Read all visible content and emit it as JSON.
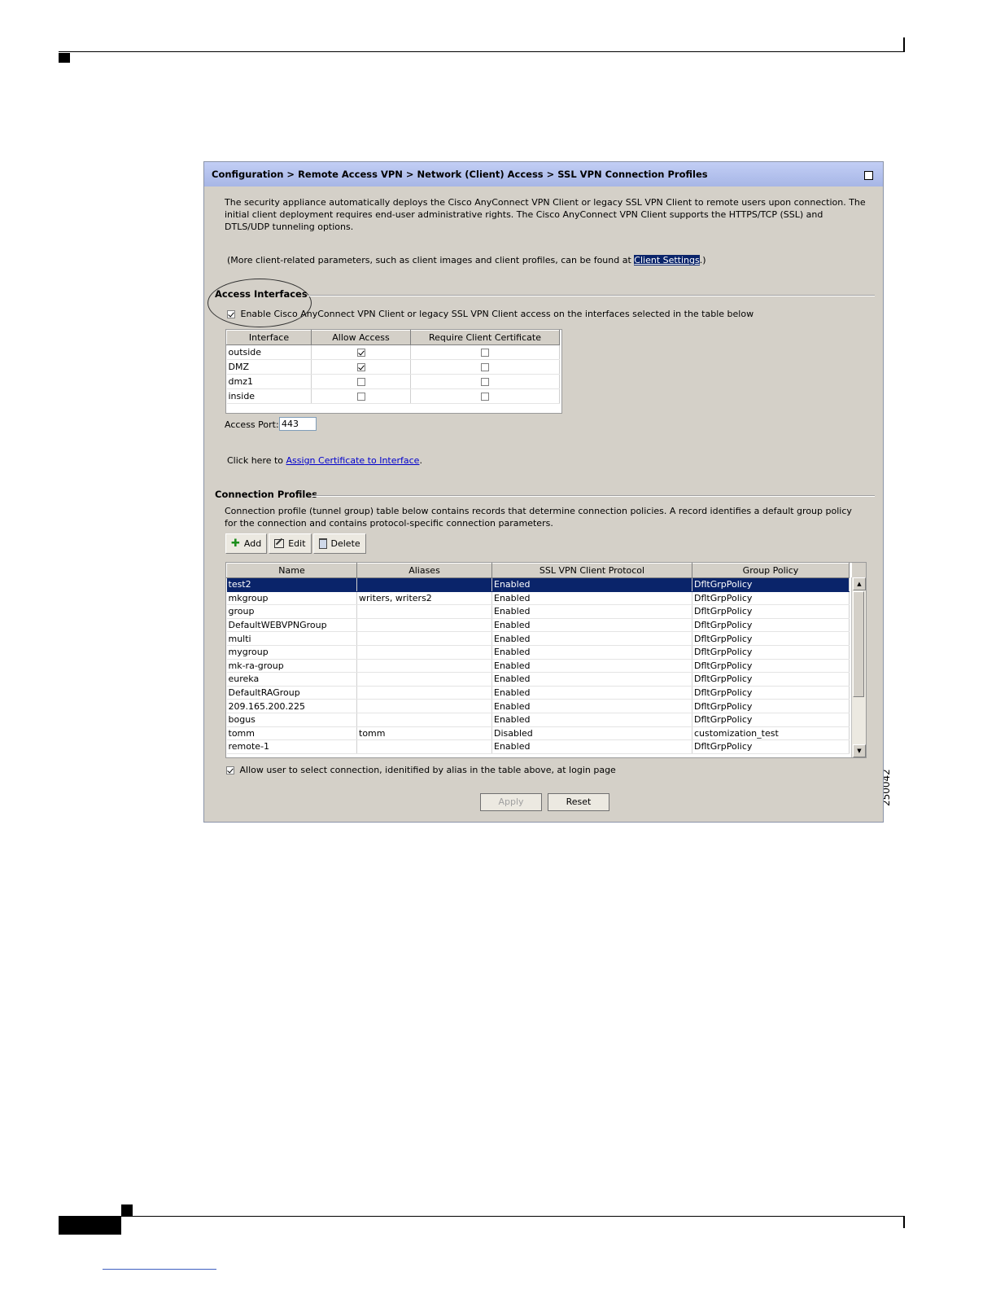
{
  "figure_id": "250042",
  "panel": {
    "breadcrumb": "Configuration > Remote Access VPN > Network (Client) Access > SSL VPN Connection Profiles",
    "intro": "The security appliance automatically deploys the Cisco AnyConnect VPN Client or legacy SSL VPN Client to remote users upon connection. The initial client deployment requires end-user administrative rights. The Cisco AnyConnect VPN Client supports the HTTPS/TCP (SSL) and DTLS/UDP tunneling options.",
    "more_prefix": "(More client-related parameters, such as client images and client profiles, can be found at ",
    "more_link": "Client Settings",
    "more_suffix": ".)"
  },
  "access_interfaces": {
    "title": "Access Interfaces",
    "enable_label": "Enable Cisco AnyConnect VPN Client or legacy SSL VPN Client access on the interfaces selected in the table below",
    "enable_checked": true,
    "columns": [
      "Interface",
      "Allow Access",
      "Require Client Certificate"
    ],
    "rows": [
      {
        "interface": "outside",
        "allow": true,
        "require_cert": false
      },
      {
        "interface": "DMZ",
        "allow": true,
        "require_cert": false
      },
      {
        "interface": "dmz1",
        "allow": false,
        "require_cert": false
      },
      {
        "interface": "inside",
        "allow": false,
        "require_cert": false
      }
    ],
    "port_label": "Access Port:",
    "port_value": "443",
    "assign_prefix": "Click here to ",
    "assign_link": "Assign Certificate to Interface",
    "assign_suffix": "."
  },
  "connection_profiles": {
    "title": "Connection Profiles",
    "description": "Connection profile (tunnel group) table below contains records that determine connection policies. A record identifies a default group policy for the connection and contains protocol-specific connection parameters.",
    "toolbar": {
      "add": "Add",
      "edit": "Edit",
      "delete": "Delete"
    },
    "columns": [
      "Name",
      "Aliases",
      "SSL VPN Client Protocol",
      "Group Policy"
    ],
    "rows": [
      [
        "test2",
        "",
        "Enabled",
        "DfltGrpPolicy"
      ],
      [
        "mkgroup",
        "writers, writers2",
        "Enabled",
        "DfltGrpPolicy"
      ],
      [
        "group",
        "",
        "Enabled",
        "DfltGrpPolicy"
      ],
      [
        "DefaultWEBVPNGroup",
        "",
        "Enabled",
        "DfltGrpPolicy"
      ],
      [
        "multi",
        "",
        "Enabled",
        "DfltGrpPolicy"
      ],
      [
        "mygroup",
        "",
        "Enabled",
        "DfltGrpPolicy"
      ],
      [
        "mk-ra-group",
        "",
        "Enabled",
        "DfltGrpPolicy"
      ],
      [
        "eureka",
        "",
        "Enabled",
        "DfltGrpPolicy"
      ],
      [
        "DefaultRAGroup",
        "",
        "Enabled",
        "DfltGrpPolicy"
      ],
      [
        "209.165.200.225",
        "",
        "Enabled",
        "DfltGrpPolicy"
      ],
      [
        "bogus",
        "",
        "Enabled",
        "DfltGrpPolicy"
      ],
      [
        "tomm",
        "tomm",
        "Disabled",
        "customization_test"
      ],
      [
        "remote-1",
        "",
        "Enabled",
        "DfltGrpPolicy"
      ]
    ],
    "selected_row": 0,
    "allow_select_label": "Allow user to select connection, idenitified by alias in the table above, at login page",
    "allow_select_checked": true
  },
  "buttons": {
    "apply": "Apply",
    "reset": "Reset"
  }
}
